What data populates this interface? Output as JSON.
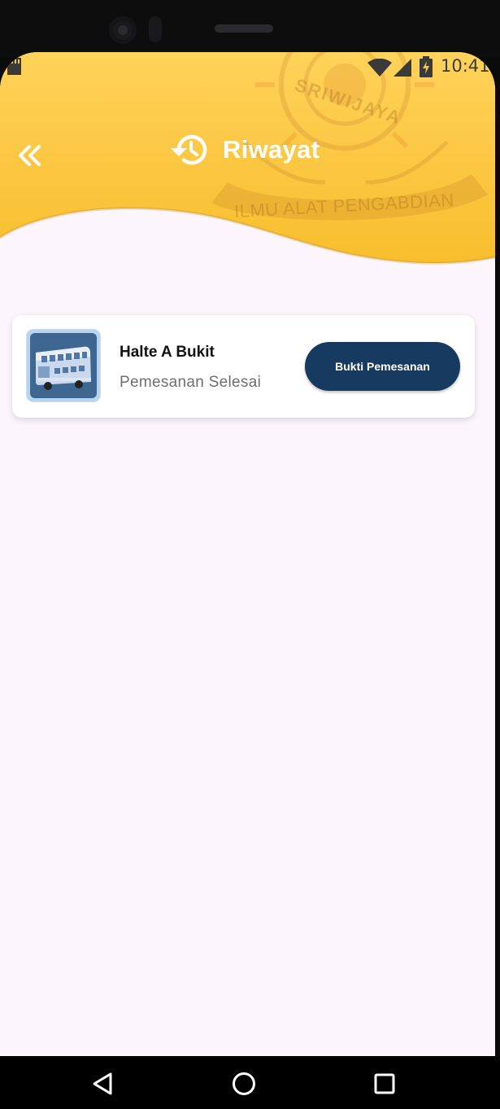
{
  "status_bar": {
    "time": "10:41",
    "icons": [
      "sd-card-icon",
      "wifi-icon",
      "signal-icon",
      "battery-charging-icon"
    ]
  },
  "header": {
    "back_icon": "double-chevron-left-icon",
    "title_icon": "history-icon",
    "title": "Riwayat",
    "emblem": {
      "text_top": "SRIWIJAYA",
      "text_bottom": "ILMU ALAT PENGABDIAN"
    },
    "colors": {
      "gradient_start": "#ffd35c",
      "gradient_end": "#f7bd2c"
    }
  },
  "history": {
    "items": [
      {
        "thumbnail_icon": "double-decker-bus-icon",
        "title": "Halte A Bukit",
        "status": "Pemesanan Selesai",
        "action_label": "Bukti Pemesanan"
      }
    ]
  },
  "nav_bar": {
    "buttons": [
      "back-triangle-icon",
      "home-circle-icon",
      "recents-square-icon"
    ]
  },
  "colors": {
    "background": "#fcf5fc",
    "button": "#173a61",
    "card": "#ffffff"
  }
}
